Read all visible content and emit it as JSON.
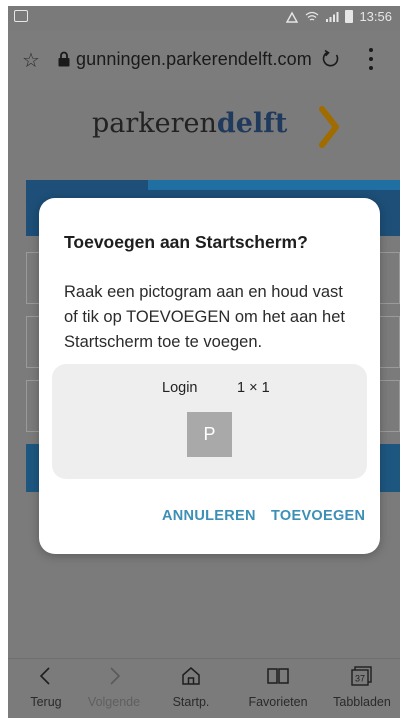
{
  "status_bar": {
    "time": "13:56"
  },
  "browser": {
    "url": "gunningen.parkerendelft.com",
    "bookmark_icon": "star-outline-icon",
    "security_icon": "lock-icon",
    "reload_icon": "reload-icon",
    "menu_icon": "more-vertical-icon"
  },
  "page": {
    "logo_part1": "parkeren",
    "logo_part2": "delft",
    "logo_accent_color": "#f5a800"
  },
  "dialog": {
    "title": "Toevoegen aan Startscherm?",
    "message_lines": [
      "Raak een pictogram aan en houd vast",
      "of tik op TOEVOEGEN om het aan het",
      "Startscherm toe te voegen."
    ],
    "shortcut_name": "Login",
    "shortcut_size": "1 × 1",
    "shortcut_icon_letter": "P",
    "cancel_label": "ANNULEREN",
    "add_label": "TOEVOEGEN",
    "accent_color": "#3c8fb6"
  },
  "bottom_nav": {
    "items": [
      {
        "label": "Terug",
        "icon": "back-icon"
      },
      {
        "label": "Volgende",
        "icon": "forward-icon"
      },
      {
        "label": "Startp.",
        "icon": "home-icon"
      },
      {
        "label": "Favorieten",
        "icon": "bookmarks-icon"
      },
      {
        "label": "Tabbladen",
        "icon": "tabs-icon",
        "badge": "37"
      }
    ]
  }
}
